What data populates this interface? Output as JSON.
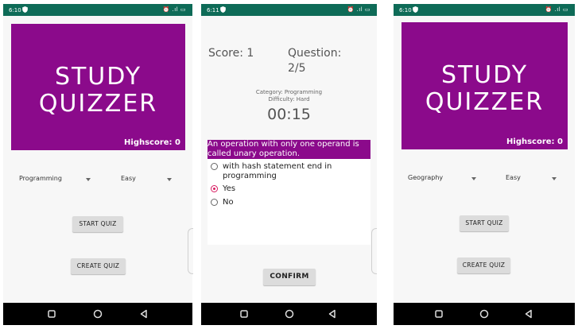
{
  "screens": [
    {
      "status_time": "6:10",
      "status_right": "⏰ .ıl ▭",
      "banner": {
        "title_line1": "STUDY",
        "title_line2": "QUIZZER",
        "highscore": "Highscore: 0"
      },
      "category_spinner": "Programming",
      "difficulty_spinner": "Easy",
      "start_button": "START QUIZ",
      "create_button": "CREATE QUIZ"
    },
    {
      "status_time": "6:11",
      "status_right": "⏰ .ıl ▭",
      "score": "Score: 1",
      "question_label": "Question:",
      "question_count": "2/5",
      "category": "Category: Programming",
      "difficulty": "Difficulty: Hard",
      "timer": "00:15",
      "question_text": "An operation with only one operand is called unary operation.",
      "options": [
        {
          "label": "with hash statement end in programming",
          "checked": false
        },
        {
          "label": "Yes",
          "checked": true
        },
        {
          "label": "No",
          "checked": false
        }
      ],
      "confirm_button": "CONFIRM"
    },
    {
      "status_time": "6:10",
      "status_right": "⏰ .ıl ▭",
      "banner": {
        "title_line1": "STUDY",
        "title_line2": "QUIZZER",
        "highscore": "Highscore: 0"
      },
      "category_spinner": "Geography",
      "difficulty_spinner": "Easy",
      "start_button": "START QUIZ",
      "create_button": "CREATE QUIZ"
    }
  ],
  "colors": {
    "status_bar": "#0e6b57",
    "banner": "#8b0a8b",
    "radio_checked": "#d81b60",
    "navbar": "#000000"
  },
  "icons": {
    "status_shield": "shield-icon",
    "nav_square": "overview-square-icon",
    "nav_circle": "home-circle-icon",
    "nav_back": "back-triangle-icon"
  }
}
